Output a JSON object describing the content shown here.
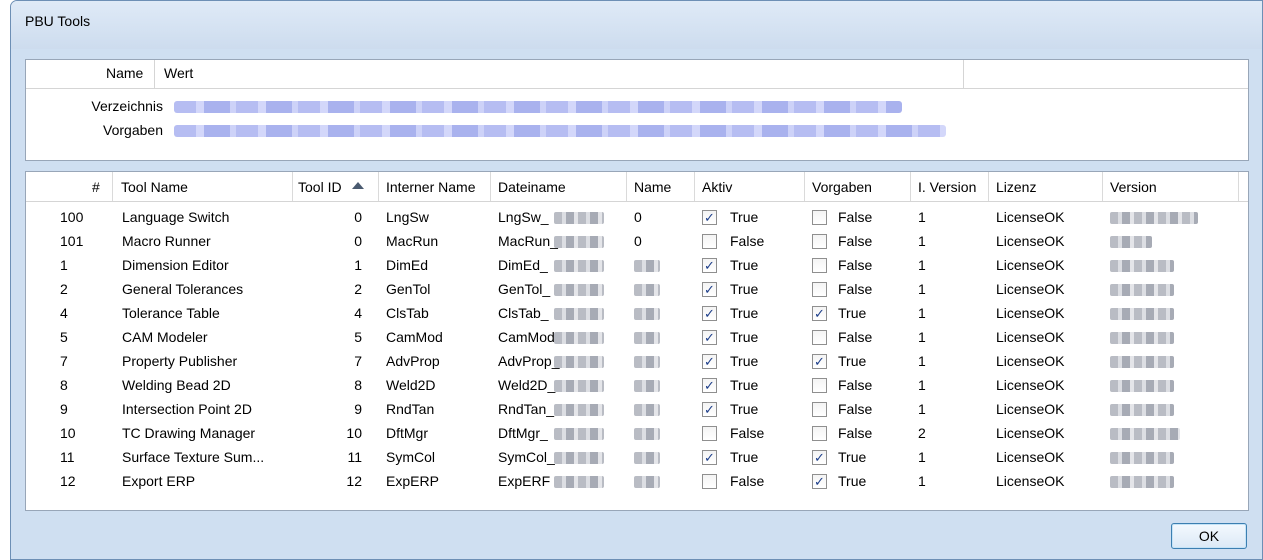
{
  "window": {
    "title": "PBU Tools"
  },
  "props": {
    "headers": {
      "name": "Name",
      "value": "Wert"
    },
    "rows": [
      {
        "label": "Verzeichnis"
      },
      {
        "label": "Vorgaben"
      }
    ]
  },
  "grid": {
    "headers": {
      "num": "#",
      "tool_name": "Tool Name",
      "tool_id": "Tool ID",
      "internal_name": "Interner Name",
      "filename": "Dateiname",
      "name": "Name",
      "aktiv": "Aktiv",
      "vorgaben": "Vorgaben",
      "iversion": "I. Version",
      "lizenz": "Lizenz",
      "version": "Version"
    },
    "rows": [
      {
        "num": "100",
        "tool_name": "Language Switch",
        "tool_id": "0",
        "internal": "LngSw",
        "file": "LngSw_",
        "name": "0",
        "aktiv": true,
        "aktiv_text": "True",
        "vorgaben": false,
        "vorgaben_text": "False",
        "iversion": "1",
        "lizenz": "LicenseOK"
      },
      {
        "num": "101",
        "tool_name": "Macro Runner",
        "tool_id": "0",
        "internal": "MacRun",
        "file": "MacRun_",
        "name": "0",
        "aktiv": false,
        "aktiv_text": "False",
        "vorgaben": false,
        "vorgaben_text": "False",
        "iversion": "1",
        "lizenz": "LicenseOK"
      },
      {
        "num": "1",
        "tool_name": "Dimension Editor",
        "tool_id": "1",
        "internal": "DimEd",
        "file": "DimEd_",
        "name": "",
        "aktiv": true,
        "aktiv_text": "True",
        "vorgaben": false,
        "vorgaben_text": "False",
        "iversion": "1",
        "lizenz": "LicenseOK"
      },
      {
        "num": "2",
        "tool_name": "General Tolerances",
        "tool_id": "2",
        "internal": "GenTol",
        "file": "GenTol_",
        "name": "",
        "aktiv": true,
        "aktiv_text": "True",
        "vorgaben": false,
        "vorgaben_text": "False",
        "iversion": "1",
        "lizenz": "LicenseOK"
      },
      {
        "num": "4",
        "tool_name": "Tolerance Table",
        "tool_id": "4",
        "internal": "ClsTab",
        "file": "ClsTab_",
        "name": "",
        "aktiv": true,
        "aktiv_text": "True",
        "vorgaben": true,
        "vorgaben_text": "True",
        "iversion": "1",
        "lizenz": "LicenseOK"
      },
      {
        "num": "5",
        "tool_name": "CAM Modeler",
        "tool_id": "5",
        "internal": "CamMod",
        "file": "CamMod",
        "name": "",
        "aktiv": true,
        "aktiv_text": "True",
        "vorgaben": false,
        "vorgaben_text": "False",
        "iversion": "1",
        "lizenz": "LicenseOK"
      },
      {
        "num": "7",
        "tool_name": "Property Publisher",
        "tool_id": "7",
        "internal": "AdvProp",
        "file": "AdvProp_",
        "name": "",
        "aktiv": true,
        "aktiv_text": "True",
        "vorgaben": true,
        "vorgaben_text": "True",
        "iversion": "1",
        "lizenz": "LicenseOK"
      },
      {
        "num": "8",
        "tool_name": "Welding Bead 2D",
        "tool_id": "8",
        "internal": "Weld2D",
        "file": "Weld2D_",
        "name": "",
        "aktiv": true,
        "aktiv_text": "True",
        "vorgaben": false,
        "vorgaben_text": "False",
        "iversion": "1",
        "lizenz": "LicenseOK"
      },
      {
        "num": "9",
        "tool_name": "Intersection Point 2D",
        "tool_id": "9",
        "internal": "RndTan",
        "file": "RndTan_",
        "name": "",
        "aktiv": true,
        "aktiv_text": "True",
        "vorgaben": false,
        "vorgaben_text": "False",
        "iversion": "1",
        "lizenz": "LicenseOK"
      },
      {
        "num": "10",
        "tool_name": "TC Drawing Manager",
        "tool_id": "10",
        "internal": "DftMgr",
        "file": "DftMgr_",
        "name": "",
        "aktiv": false,
        "aktiv_text": "False",
        "vorgaben": false,
        "vorgaben_text": "False",
        "iversion": "2",
        "lizenz": "LicenseOK"
      },
      {
        "num": "11",
        "tool_name": "Surface Texture Sum...",
        "tool_id": "11",
        "internal": "SymCol",
        "file": "SymCol_",
        "name": "",
        "aktiv": true,
        "aktiv_text": "True",
        "vorgaben": true,
        "vorgaben_text": "True",
        "iversion": "1",
        "lizenz": "LicenseOK"
      },
      {
        "num": "12",
        "tool_name": "Export ERP",
        "tool_id": "12",
        "internal": "ExpERP",
        "file": "ExpERF",
        "name": "",
        "aktiv": false,
        "aktiv_text": "False",
        "vorgaben": true,
        "vorgaben_text": "True",
        "iversion": "1",
        "lizenz": "LicenseOK"
      }
    ]
  },
  "buttons": {
    "ok": "OK"
  }
}
